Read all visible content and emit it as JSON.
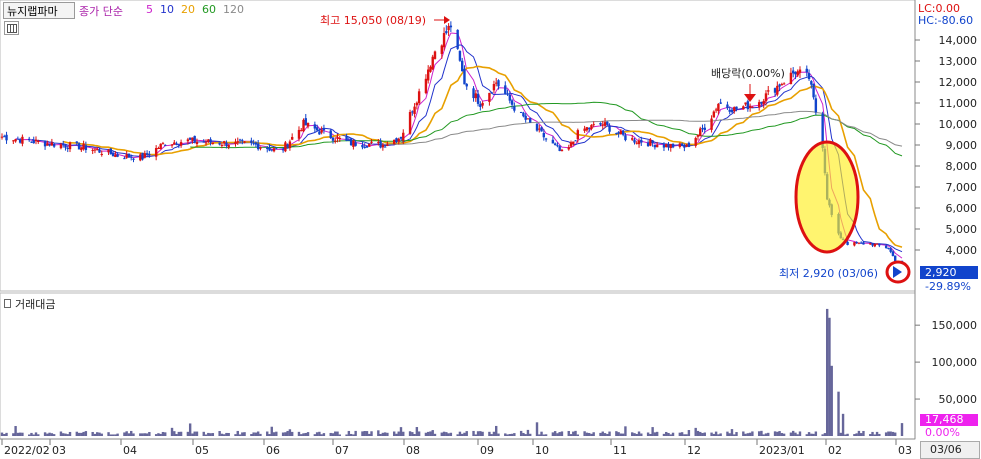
{
  "header": {
    "stock_name": "뉴지랩파마",
    "ma_label": "종가 단순",
    "ma_periods": [
      "5",
      "10",
      "20",
      "60",
      "120"
    ],
    "ma_colors": [
      "#cc22cc",
      "#2233cc",
      "#e8a000",
      "#229922",
      "#8a8a8a"
    ],
    "lc_label": "LC:0.00",
    "hc_label": "HC:-80.60"
  },
  "volume_header": {
    "label": "거래대금"
  },
  "annotations": {
    "high_label": "최고 15,050 (08/19)",
    "low_label": "최저 2,920 (03/06)",
    "dividend_label": "배당락(0.00%)"
  },
  "price_axis": {
    "ticks": [
      "14,000",
      "13,000",
      "12,000",
      "11,000",
      "10,000",
      "9,000",
      "8,000",
      "7,000",
      "6,000",
      "5,000",
      "4,000"
    ],
    "current_price": "2,920",
    "current_change": "-29.89%"
  },
  "volume_axis": {
    "ticks": [
      "150,000",
      "100,000",
      "50,000"
    ],
    "current_value": "17,468",
    "current_change": "0.00%"
  },
  "x_axis": {
    "ticks": [
      "2022/02",
      "03",
      "04",
      "05",
      "06",
      "07",
      "08",
      "09",
      "10",
      "11",
      "12",
      "2023/01",
      "02",
      "03"
    ],
    "cursor_label": "03/06"
  },
  "colors": {
    "up": "#dd1111",
    "down": "#1144cc",
    "volume": "#66669a",
    "highlight": "#ffee22",
    "circle": "#dd1111"
  },
  "chart_data": {
    "type": "candlestick",
    "period": "daily",
    "y_range": [
      3500,
      15300
    ],
    "volume_range": [
      0,
      180000
    ],
    "price_path": [
      [
        "2022-02-02",
        9400
      ],
      [
        "2022-02-20",
        9100
      ],
      [
        "2022-03-10",
        8900
      ],
      [
        "2022-03-25",
        8500
      ],
      [
        "2022-04-05",
        8400
      ],
      [
        "2022-04-15",
        9100
      ],
      [
        "2022-04-25",
        9200
      ],
      [
        "2022-05-10",
        9100
      ],
      [
        "2022-05-25",
        9000
      ],
      [
        "2022-06-05",
        8700
      ],
      [
        "2022-06-15",
        10000
      ],
      [
        "2022-06-25",
        9500
      ],
      [
        "2022-07-05",
        9100
      ],
      [
        "2022-07-20",
        9000
      ],
      [
        "2022-07-28",
        9400
      ],
      [
        "2022-08-05",
        11500
      ],
      [
        "2022-08-12",
        13500
      ],
      [
        "2022-08-19",
        14700
      ],
      [
        "2022-08-25",
        12000
      ],
      [
        "2022-09-01",
        11000
      ],
      [
        "2022-09-08",
        12000
      ],
      [
        "2022-09-18",
        10500
      ],
      [
        "2022-09-28",
        9500
      ],
      [
        "2022-10-08",
        8500
      ],
      [
        "2022-10-15",
        9700
      ],
      [
        "2022-10-25",
        10000
      ],
      [
        "2022-11-05",
        9300
      ],
      [
        "2022-11-20",
        9000
      ],
      [
        "2022-12-01",
        8900
      ],
      [
        "2022-12-10",
        10000
      ],
      [
        "2022-12-15",
        11000
      ],
      [
        "2022-12-22",
        10700
      ],
      [
        "2023-01-01",
        11000
      ],
      [
        "2023-01-10",
        11800
      ],
      [
        "2023-01-18",
        12500
      ],
      [
        "2023-01-24",
        12200
      ],
      [
        "2023-01-30",
        9000
      ],
      [
        "2023-02-01",
        6500
      ],
      [
        "2023-02-05",
        4800
      ],
      [
        "2023-02-10",
        4300
      ],
      [
        "2023-02-20",
        4300
      ],
      [
        "2023-02-28",
        4100
      ],
      [
        "2023-03-06",
        2920
      ]
    ],
    "volume_spikes": [
      [
        "2023-02-01",
        172000
      ],
      [
        "2023-02-02",
        160000
      ],
      [
        "2023-02-03",
        95000
      ],
      [
        "2023-02-06",
        60000
      ],
      [
        "2023-02-08",
        30000
      ],
      [
        "2023-03-06",
        17468
      ]
    ]
  }
}
